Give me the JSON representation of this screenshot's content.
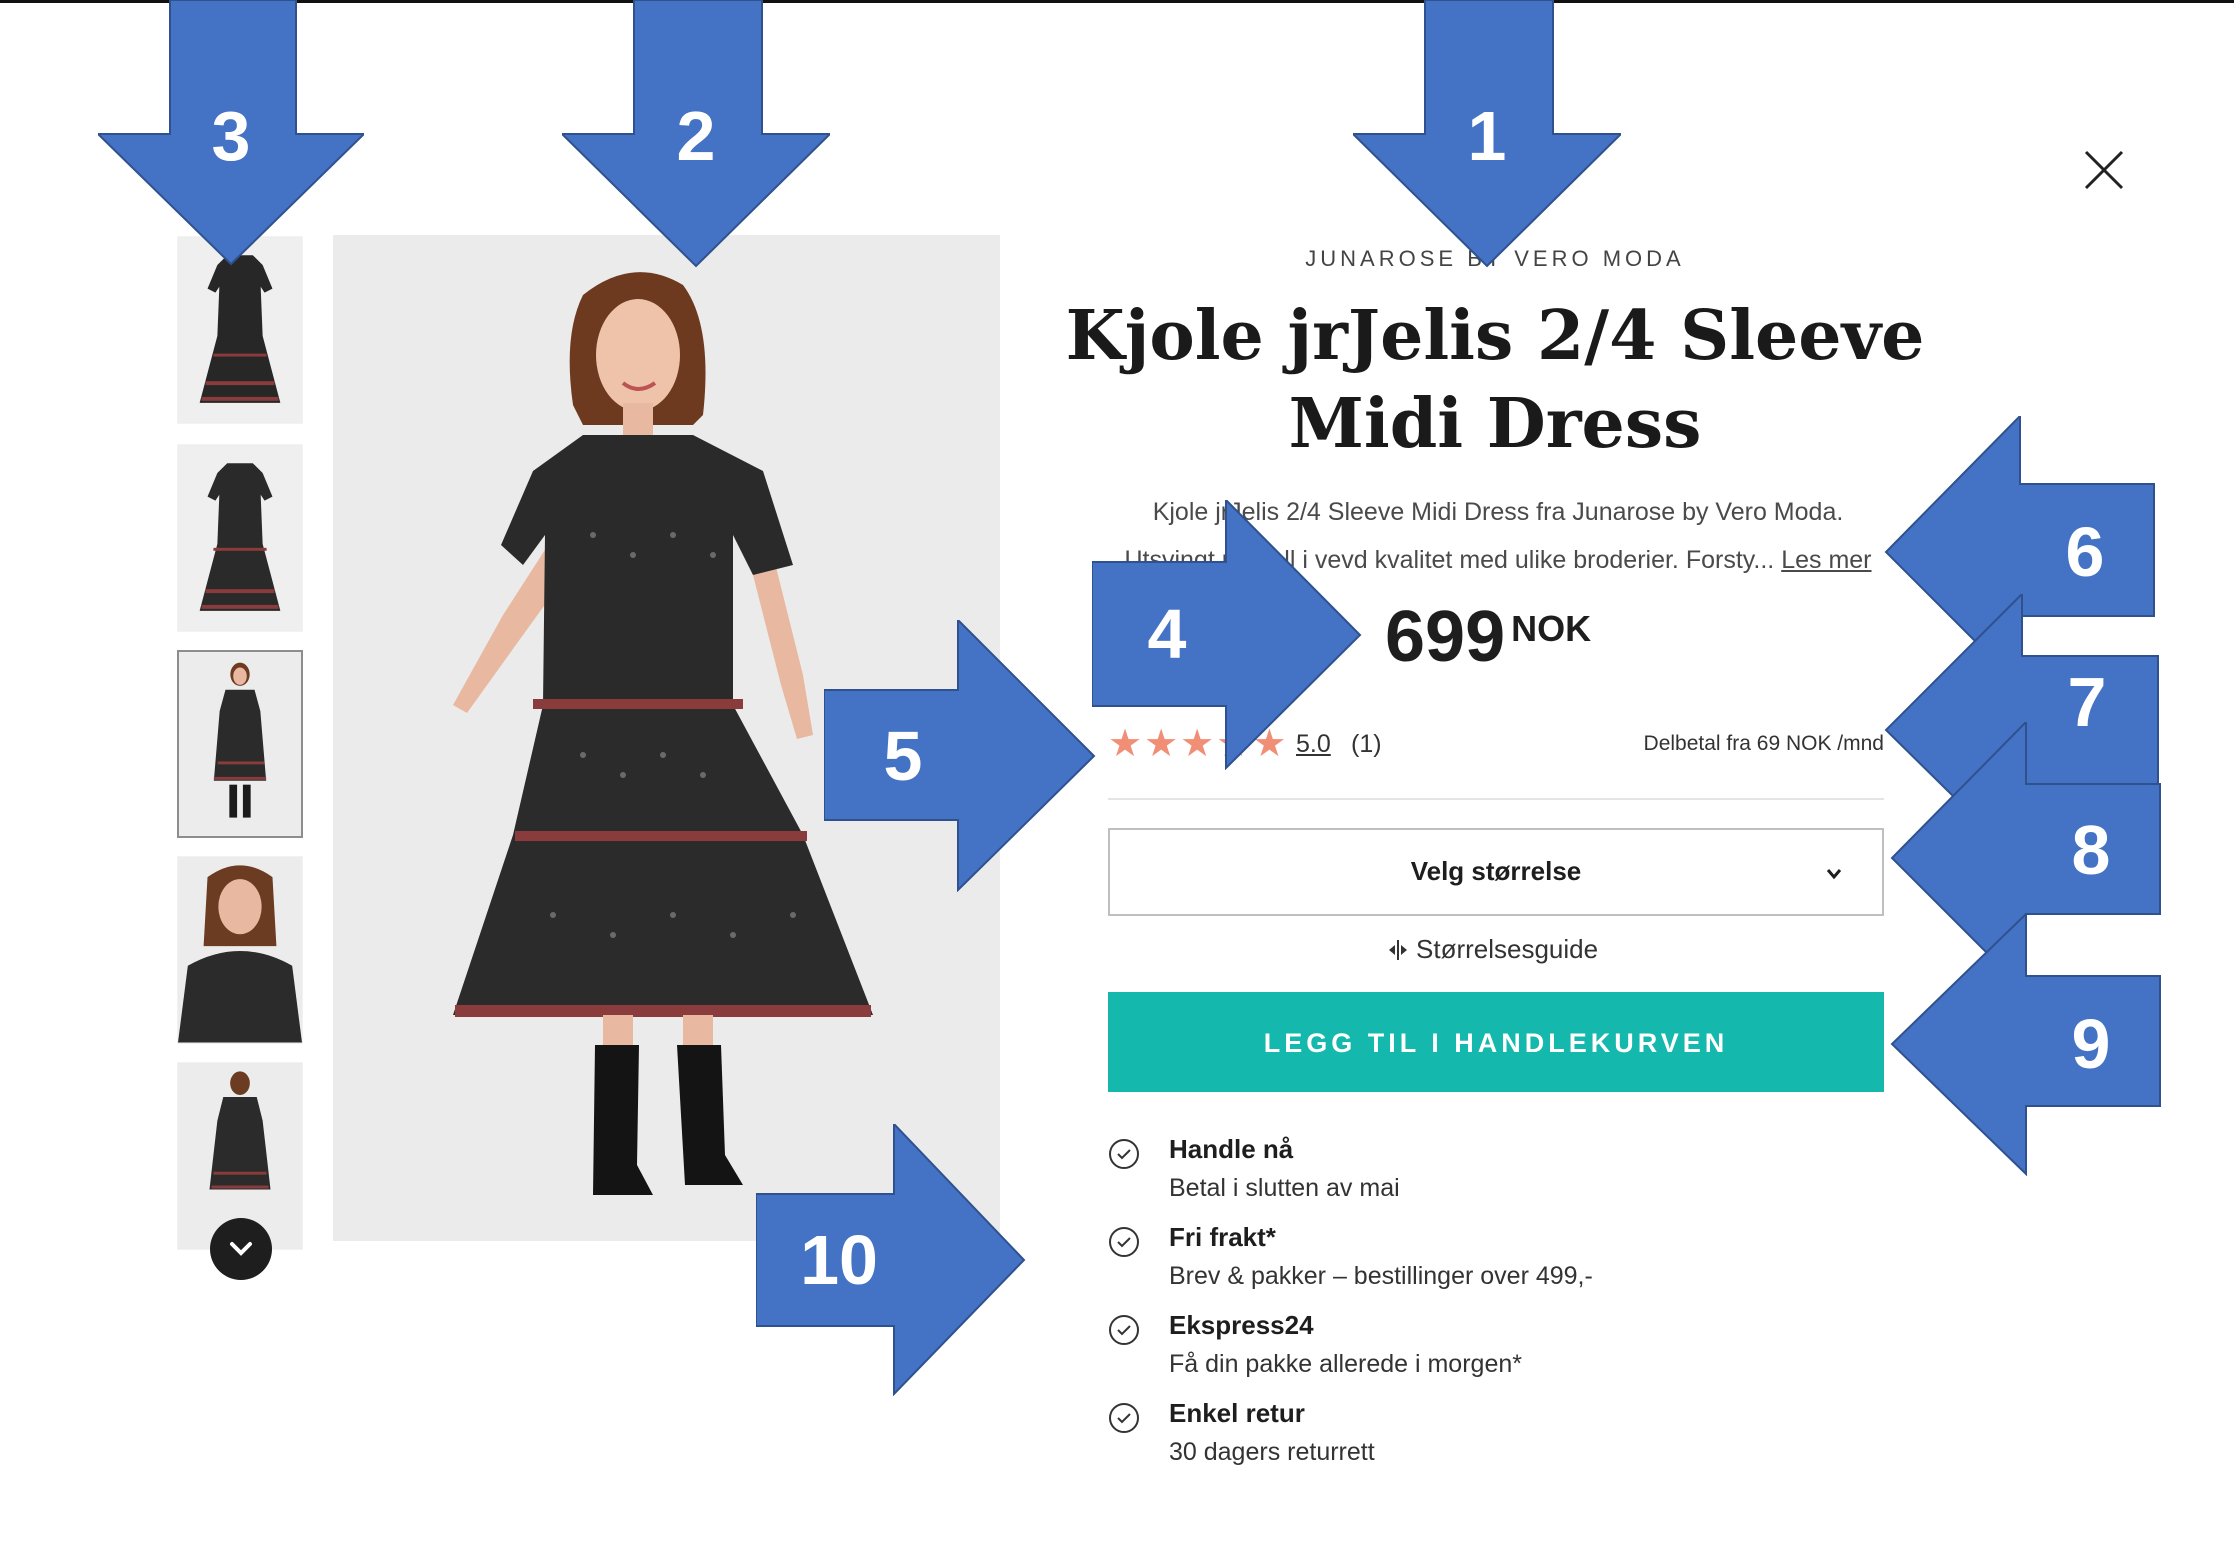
{
  "product": {
    "brand": "JUNAROSE BY VERO MODA",
    "title": "Kjole jrJelis 2/4 Sleeve Midi Dress",
    "description_line1": "Kjole jrJelis 2/4 Sleeve Midi Dress fra Junarose by Vero Moda.",
    "description_line2": "Utsvingt modell i vevd kvalitet med ulike broderier. Forsty...",
    "read_more": "Les mer",
    "price": "699",
    "currency": "NOK",
    "rating_value": "5.0",
    "rating_count": "(1)",
    "stars": [
      "★",
      "★",
      "★",
      "★",
      "★"
    ],
    "installment": "Delbetal fra 69 NOK /mnd"
  },
  "size_select": {
    "label": "Velg størrelse",
    "guide": "Størrelsesguide"
  },
  "cart_button": "LEGG TIL I HANDLEKURVEN",
  "features": [
    {
      "title": "Handle nå",
      "subtitle": "Betal i slutten av mai"
    },
    {
      "title": "Fri frakt*",
      "subtitle": "Brev & pakker – bestillinger over 499,-"
    },
    {
      "title": "Ekspress24",
      "subtitle": "Få din pakke allerede i morgen*"
    },
    {
      "title": "Enkel retur",
      "subtitle": "30 dagers returrett"
    }
  ],
  "annotations": [
    "1",
    "2",
    "3",
    "4",
    "5",
    "6",
    "7",
    "8",
    "9",
    "10"
  ],
  "colors": {
    "accent": "#14b8ac",
    "star": "#f08e76",
    "arrow": "#4472c4",
    "arrow_border": "#2f528f"
  },
  "icons": {
    "close": "close-icon",
    "chevron": "chevron-down-icon",
    "check": "check-circle-icon",
    "size_guide": "ruler-arrows-icon"
  }
}
